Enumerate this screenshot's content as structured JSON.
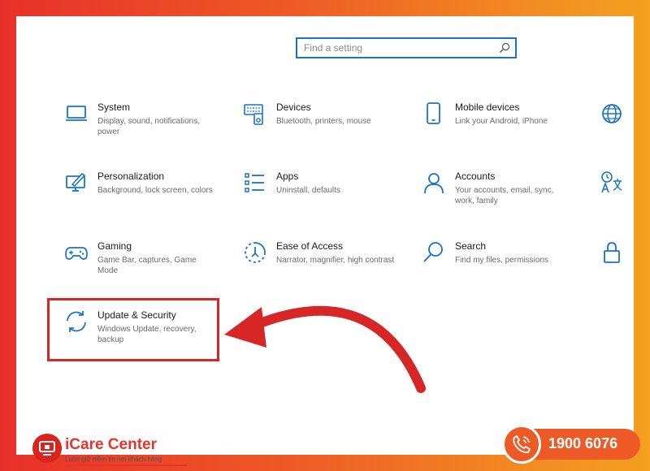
{
  "search": {
    "placeholder": "Find a setting"
  },
  "tiles": [
    {
      "name": "System",
      "desc": "Display, sound, notifications, power",
      "icon": "monitor-icon"
    },
    {
      "name": "Devices",
      "desc": "Bluetooth, printers, mouse",
      "icon": "devices-icon"
    },
    {
      "name": "Mobile devices",
      "desc": "Link your Android, iPhone",
      "icon": "phone-icon"
    },
    {
      "name": "Personalization",
      "desc": "Background, lock screen, colors",
      "icon": "personalization-icon"
    },
    {
      "name": "Apps",
      "desc": "Uninstall, defaults",
      "icon": "apps-icon"
    },
    {
      "name": "Accounts",
      "desc": "Your accounts, email, sync, work, family",
      "icon": "person-icon"
    },
    {
      "name": "Gaming",
      "desc": "Game Bar, captures, Game Mode",
      "icon": "gamepad-icon"
    },
    {
      "name": "Ease of Access",
      "desc": "Narrator, magnifier, high contrast",
      "icon": "ease-of-access-icon"
    },
    {
      "name": "Search",
      "desc": "Find my files, permissions",
      "icon": "search-icon"
    },
    {
      "name": "Update & Security",
      "desc": "Windows Update, recovery, backup",
      "icon": "sync-icon"
    }
  ],
  "partial_icons": [
    "globe-icon",
    "time-language-icon",
    "lock-icon"
  ],
  "brand": {
    "name": "iCare Center",
    "slogan": "Luôn giữ niềm tin nơi khách hàng",
    "phone": "1900 6076"
  },
  "colors": {
    "accent": "#1a73c8",
    "highlight": "#d72626",
    "brand_red": "#e8332a",
    "brand_orange": "#ee5a26"
  }
}
